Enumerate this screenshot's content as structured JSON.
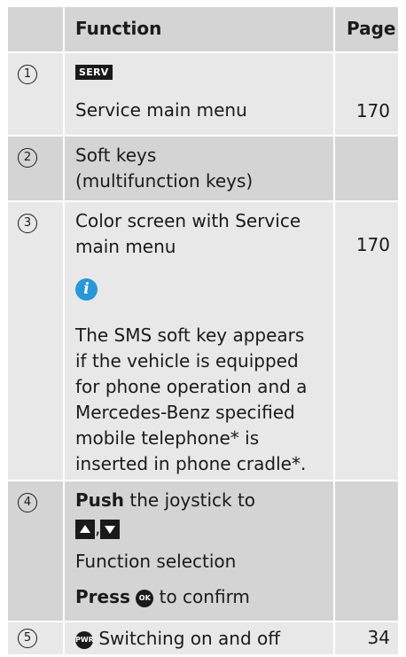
{
  "header": {
    "num": "",
    "function": "Function",
    "page": "Page"
  },
  "rows": [
    {
      "num": "1",
      "key_label": "SERV",
      "text": "Service main menu",
      "page": "170"
    },
    {
      "num": "2",
      "text_line1": "Soft keys",
      "text_line2": "(multifunction keys)",
      "page": ""
    },
    {
      "num": "3",
      "text_line1": "Color screen with Service",
      "text_line2": "main menu",
      "page": "170",
      "note_lines": [
        "The SMS soft key appears",
        "if the vehicle is equipped",
        "for phone operation and a",
        "Mercedes-Benz specified",
        "mobile telephone* is",
        "inserted in phone cradle*."
      ]
    },
    {
      "num": "4",
      "push_bold": "Push",
      "push_rest": " the joystick to",
      "separator": ",",
      "selection": "Function selection",
      "press_bold": "Press",
      "ok_label": "OK",
      "press_rest": " to confirm",
      "page": ""
    },
    {
      "num": "5",
      "pwr_label": "PWR",
      "text": " Switching on and off",
      "page": "34"
    }
  ],
  "colors": {
    "header_bg": "#d4d4d4",
    "light_bg": "#e8e8e8",
    "info_blue": "#2996d8"
  },
  "icons": [
    "info-icon",
    "arrow-up-key-icon",
    "arrow-down-key-icon",
    "ok-button-icon",
    "power-button-icon"
  ]
}
